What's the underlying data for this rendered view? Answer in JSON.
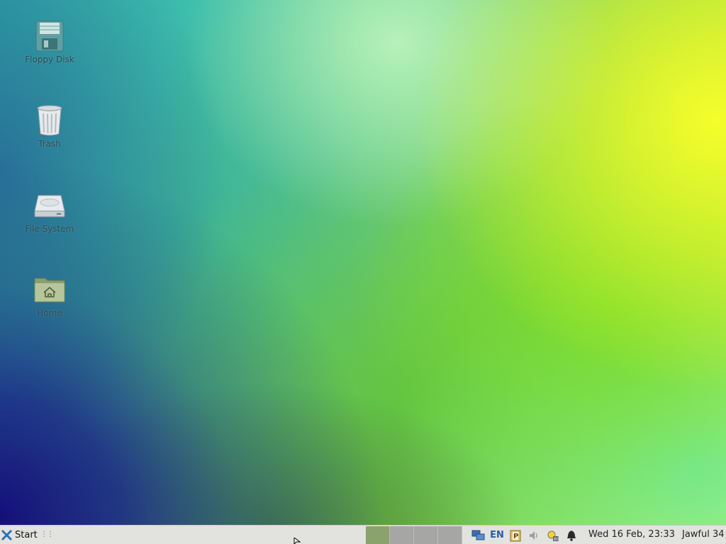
{
  "desktop": {
    "icons": [
      {
        "label": "Floppy Disk",
        "icon": "floppy-disk-icon"
      },
      {
        "label": "Trash",
        "icon": "trash-icon"
      },
      {
        "label": "File System",
        "icon": "hard-drive-icon"
      },
      {
        "label": "Home",
        "icon": "home-folder-icon"
      }
    ],
    "colors": {
      "yellow": "#f6ff3a",
      "green": "#7ad63a",
      "teal": "#3fc1b0",
      "navy": "#14107a"
    }
  },
  "taskbar": {
    "start_label": "Start",
    "workspaces": [
      {
        "name": "workspace-1",
        "active": true
      },
      {
        "name": "workspace-2",
        "active": false
      },
      {
        "name": "workspace-3",
        "active": false
      },
      {
        "name": "workspace-4",
        "active": false
      }
    ],
    "tray": {
      "network_icon": "network-icon",
      "keyboard_layout": "EN",
      "clipboard_icon": "clipboard-icon",
      "volume_icon": "volume-icon",
      "updates_icon": "updates-icon",
      "notifications_icon": "bell-icon"
    },
    "clock": "Wed 16 Feb, 23:33",
    "user": "Jawful 34"
  }
}
